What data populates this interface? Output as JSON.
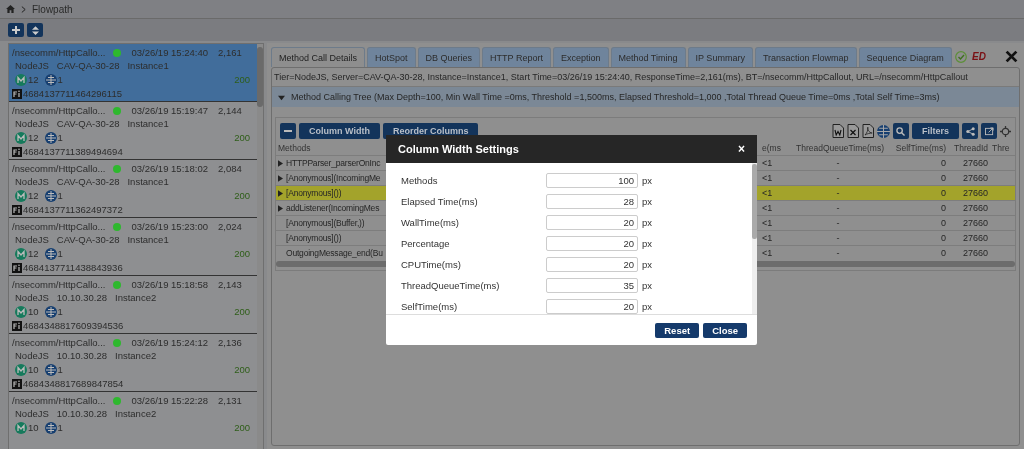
{
  "breadcrumb": {
    "items": [
      "Flowpath"
    ]
  },
  "flowpaths": [
    {
      "url": "/nsecomm/HttpCallo...",
      "time": "03/26/19 15:24:40",
      "duration": "2,161",
      "tier": "NodeJS",
      "server": "CAV-QA-30-28",
      "instance": "Instance1",
      "methods": "12",
      "calls": "1",
      "status": "200",
      "id": "4684137711464296115",
      "selected": true,
      "color": "#2eb82e"
    },
    {
      "url": "/nsecomm/HttpCallo...",
      "time": "03/26/19 15:19:47",
      "duration": "2,144",
      "tier": "NodeJS",
      "server": "CAV-QA-30-28",
      "instance": "Instance1",
      "methods": "12",
      "calls": "1",
      "status": "200",
      "id": "4684137711389494694",
      "selected": false,
      "color": "#2eb82e"
    },
    {
      "url": "/nsecomm/HttpCallo...",
      "time": "03/26/19 15:18:02",
      "duration": "2,084",
      "tier": "NodeJS",
      "server": "CAV-QA-30-28",
      "instance": "Instance1",
      "methods": "12",
      "calls": "1",
      "status": "200",
      "id": "4684137711362497372",
      "selected": false,
      "color": "#2eb82e"
    },
    {
      "url": "/nsecomm/HttpCallo...",
      "time": "03/26/19 15:23:00",
      "duration": "2,024",
      "tier": "NodeJS",
      "server": "CAV-QA-30-28",
      "instance": "Instance1",
      "methods": "12",
      "calls": "1",
      "status": "200",
      "id": "4684137711438843936",
      "selected": false,
      "color": "#2eb82e"
    },
    {
      "url": "/nsecomm/HttpCallo...",
      "time": "03/26/19 15:18:58",
      "duration": "2,143",
      "tier": "NodeJS",
      "server": "10.10.30.28",
      "instance": "Instance2",
      "methods": "10",
      "calls": "1",
      "status": "200",
      "id": "4684348817609394536",
      "selected": false,
      "color": "#2eb82e"
    },
    {
      "url": "/nsecomm/HttpCallo...",
      "time": "03/26/19 15:24:12",
      "duration": "2,136",
      "tier": "NodeJS",
      "server": "10.10.30.28",
      "instance": "Instance2",
      "methods": "10",
      "calls": "1",
      "status": "200",
      "id": "4684348817689847854",
      "selected": false,
      "color": "#2eb82e"
    },
    {
      "url": "/nsecomm/HttpCallo...",
      "time": "03/26/19 15:22:28",
      "duration": "2,131",
      "tier": "NodeJS",
      "server": "10.10.30.28",
      "instance": "Instance2",
      "methods": "10",
      "calls": "1",
      "status": "200",
      "selected": false,
      "color": "#2eb82e"
    }
  ],
  "tabs": [
    {
      "label": "Method Call Details",
      "selected": true
    },
    {
      "label": "HotSpot",
      "selected": false
    },
    {
      "label": "DB Queries",
      "selected": false
    },
    {
      "label": "HTTP Report",
      "selected": false
    },
    {
      "label": "Exception",
      "selected": false
    },
    {
      "label": "Method Timing",
      "selected": false
    },
    {
      "label": "IP Summary",
      "selected": false
    },
    {
      "label": "Transaction Flowmap",
      "selected": false
    },
    {
      "label": "Sequence Diagram",
      "selected": false
    }
  ],
  "status_badge": "ED",
  "info_line": "Tier=NodeJS, Server=CAV-QA-30-28, Instance=Instance1, Start Time=03/26/19 15:24:40, ResponseTime=2,161(ms), BT=/nsecomm/HttpCallout, URL=/nsecomm/HttpCallout",
  "tree_panel": {
    "title": "Method Calling Tree (Max Depth=100, Min Wall Time =0ms, Threshold =1,500ms, Elapsed Threshold=1,000 ,Total Thread Queue Time=0ms ,Total Self Time=3ms)",
    "expanded": true
  },
  "toolbar": {
    "buttons": [
      "Column Width",
      "Reorder Columns"
    ],
    "filter_button": "Filters"
  },
  "table": {
    "columns": [
      "Methods",
      "e(ms",
      "ThreadQueueTime(ms)",
      "SelfTime(ms)",
      "ThreadId",
      "Thre"
    ],
    "rows": [
      {
        "cells": [
          "HTTPParser_parserOnInc",
          "<1",
          "-",
          "0",
          "27660"
        ],
        "expandable": true,
        "selected": false
      },
      {
        "cells": [
          "[Anonymous](IncomingMe",
          "<1",
          "-",
          "0",
          "27660"
        ],
        "expandable": true,
        "selected": false
      },
      {
        "cells": [
          "[Anonymous]())",
          "<1",
          "-",
          "0",
          "27660"
        ],
        "expandable": true,
        "selected": true
      },
      {
        "cells": [
          "addListener(IncomingMes",
          "<1",
          "-",
          "0",
          "27660"
        ],
        "expandable": true,
        "selected": false
      },
      {
        "cells": [
          "[Anonymous](Buffer,))",
          "<1",
          "-",
          "0",
          "27660"
        ],
        "expandable": false,
        "selected": false
      },
      {
        "cells": [
          "[Anonymous]())",
          "<1",
          "-",
          "0",
          "27660"
        ],
        "expandable": false,
        "selected": false
      },
      {
        "cells": [
          "OutgoingMessage_end(Bu",
          "<1",
          "-",
          "0",
          "27660"
        ],
        "expandable": false,
        "selected": false
      }
    ]
  },
  "dialog": {
    "title": "Column Width Settings",
    "close": "×",
    "fields": [
      {
        "label": "Methods",
        "value": "100",
        "unit": "px"
      },
      {
        "label": "Elapsed Time(ms)",
        "value": "28",
        "unit": "px"
      },
      {
        "label": "WallTime(ms)",
        "value": "20",
        "unit": "px"
      },
      {
        "label": "Percentage",
        "value": "20",
        "unit": "px"
      },
      {
        "label": "CPUTime(ms)",
        "value": "20",
        "unit": "px"
      },
      {
        "label": "ThreadQueueTime(ms)",
        "value": "35",
        "unit": "px"
      },
      {
        "label": "SelfTime(ms)",
        "value": "20",
        "unit": "px"
      }
    ],
    "buttons": [
      "Reset",
      "Close"
    ]
  }
}
